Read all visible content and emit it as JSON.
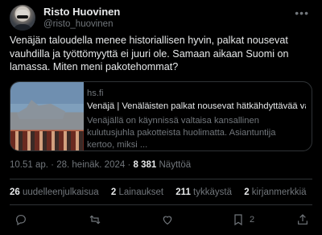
{
  "author": {
    "name": "Risto Huovinen",
    "handle": "@risto_huovinen"
  },
  "more_icon": "more-horizontal-icon",
  "tweet_text": "Venäjän taloudella menee historiallisen hyvin, palkat nousevat vauhdilla ja työttömyyttä ei juuri ole. Samaan aikaan Suomi on lamassa. Miten meni pakotehommat?",
  "card": {
    "domain": "hs.fi",
    "title": "Venäjä | Venäläisten palkat nousevat hätkähdyttävää vauhti",
    "description": "Venäjällä on käynnissä valtaisa kansallinen kulutusjuhla pakotteista huolimatta. Asiantuntija kertoo, miksi ..."
  },
  "meta": {
    "time": "10.51 ap.",
    "separator": "·",
    "date": "28. heinäk. 2024",
    "views_count": "8 381",
    "views_label": "Näyttöä"
  },
  "stats": [
    {
      "count": "26",
      "label": "uudelleenjulkaisua"
    },
    {
      "count": "2",
      "label": "Lainaukset"
    },
    {
      "count": "211",
      "label": "tykkäystä"
    },
    {
      "count": "2",
      "label": "kirjanmerkkiä"
    }
  ],
  "actions": [
    {
      "icon": "reply-icon",
      "count": ""
    },
    {
      "icon": "retweet-icon",
      "count": ""
    },
    {
      "icon": "like-icon",
      "count": ""
    },
    {
      "icon": "bookmark-icon",
      "count": "2"
    },
    {
      "icon": "share-icon",
      "count": ""
    }
  ],
  "colors": {
    "background": "#000000",
    "text": "#e7e9ea",
    "secondary": "#71767b",
    "border": "#2f3336"
  }
}
